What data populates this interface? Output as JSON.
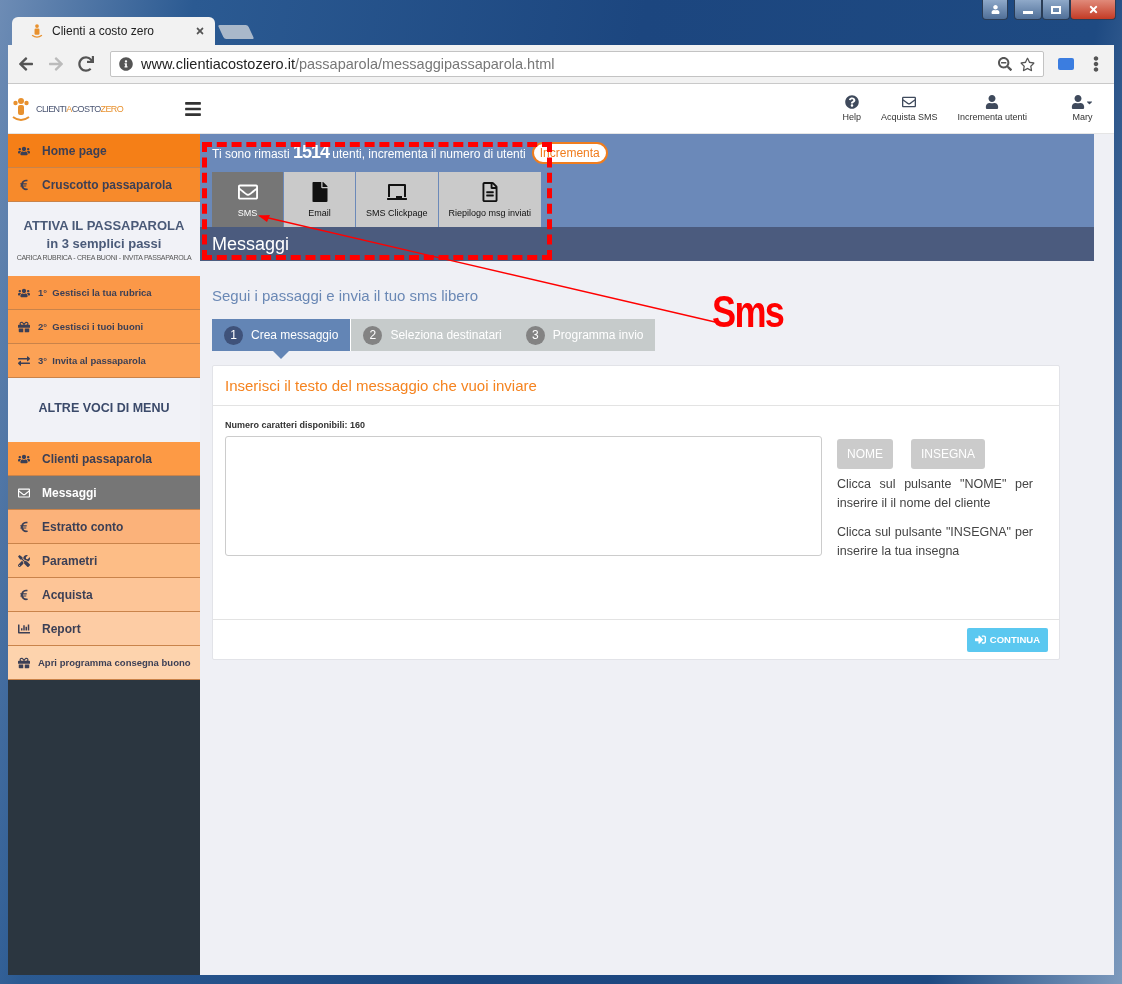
{
  "browser": {
    "tab_title": "Clienti a costo zero",
    "url_host": "www.clientiacostozero.it",
    "url_path": "/passaparola/messaggipassaparola.html"
  },
  "header": {
    "logo": [
      {
        "text": "CLIENTI",
        "accent": false
      },
      {
        "text": "A",
        "accent": true
      },
      {
        "text": "COSTO",
        "accent": false
      },
      {
        "text": "ZERO",
        "accent": true
      }
    ],
    "actions": [
      {
        "label": "Help"
      },
      {
        "label": "Acquista SMS"
      },
      {
        "label": "Incrementa utenti"
      }
    ],
    "user": {
      "name": "Mary"
    }
  },
  "sidebar": [
    {
      "kind": "link",
      "label": "Home page",
      "selected": false
    },
    {
      "kind": "link",
      "label": "Cruscotto passaparola",
      "selected": false
    },
    {
      "kind": "promo",
      "title": "ATTIVA IL PASSAPAROLA",
      "subtitle": "in 3 semplici passi",
      "note": "CARICA RUBRICA - CREA BUONI - INVITA PASSAPAROLA"
    },
    {
      "kind": "link",
      "label": "1°  Gestisci la tua rubrica",
      "selected": false
    },
    {
      "kind": "link",
      "label": "2°  Gestisci i tuoi buoni",
      "selected": false
    },
    {
      "kind": "link",
      "label": "3°  Invita al passaparola",
      "selected": false
    },
    {
      "kind": "heading",
      "title": "ALTRE VOCI DI MENU"
    },
    {
      "kind": "link",
      "label": "Clienti passaparola",
      "selected": false
    },
    {
      "kind": "link",
      "label": "Messaggi",
      "selected": true
    },
    {
      "kind": "link",
      "label": "Estratto conto",
      "selected": false
    },
    {
      "kind": "link",
      "label": "Parametri",
      "selected": false
    },
    {
      "kind": "link",
      "label": "Acquista",
      "selected": false
    },
    {
      "kind": "link",
      "label": "Report",
      "selected": false
    },
    {
      "kind": "link",
      "label": "Apri programma consegna buono",
      "selected": false
    }
  ],
  "notice": {
    "before": "Ti sono rimasti",
    "count": "1514",
    "after": "utenti, incrementa il numero di utenti",
    "button": "Incrementa"
  },
  "tools": [
    {
      "label": "SMS",
      "selected": true
    },
    {
      "label": "Email",
      "selected": false
    },
    {
      "label": "SMS Clickpage",
      "selected": false
    },
    {
      "label": "Riepilogo msg inviati",
      "selected": false
    }
  ],
  "section_title": "Messaggi",
  "intro": "Segui i passaggi e invia il tuo sms libero",
  "steps": [
    {
      "number": "1",
      "label": "Crea messaggio",
      "selected": true
    },
    {
      "number": "2",
      "label": "Seleziona destinatari",
      "selected": false
    },
    {
      "number": "3",
      "label": "Programma invio",
      "selected": false
    }
  ],
  "card": {
    "title": "Inserisci il testo del messaggio che vuoi inviare",
    "counter_label": "Numero caratteri disponibili: 160",
    "insert_buttons": [
      "NOME",
      "INSEGNA"
    ],
    "help": [
      "Clicca sul pulsante \"NOME\" per inserire il il nome del cliente",
      "Clicca sul pulsante \"INSEGNA\" per inserire la tua insegna"
    ],
    "submit": "CONTINUA"
  },
  "annotation": {
    "label": "Sms"
  }
}
